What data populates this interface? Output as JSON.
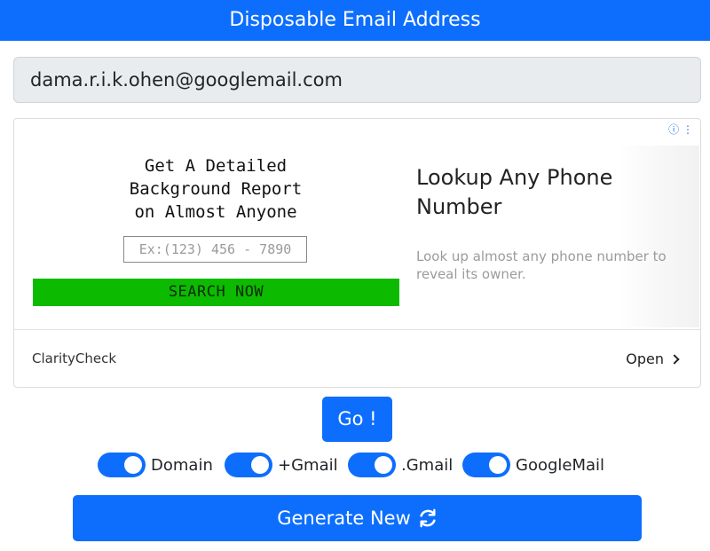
{
  "header": {
    "title": "Disposable Email Address"
  },
  "email": {
    "value": "dama.r.i.k.ohen@googlemail.com"
  },
  "ad": {
    "info_glyphs": "ⓘ ⋮",
    "image_headline": "Get A Detailed\nBackground Report\non Almost Anyone",
    "image_input_placeholder": "Ex:(123) 456 - 7890",
    "image_button_label": "SEARCH NOW",
    "headline": "Lookup Any Phone Number",
    "description": "Look up almost any phone number to reveal its owner.",
    "advertiser": "ClarityCheck",
    "open_label": "Open"
  },
  "go_button": {
    "label": "Go !"
  },
  "toggles": [
    {
      "label": "Domain",
      "on": true
    },
    {
      "label": "+Gmail",
      "on": true
    },
    {
      "label": ".Gmail",
      "on": true
    },
    {
      "label": "GoogleMail",
      "on": true
    }
  ],
  "generate_button": {
    "label": "Generate New",
    "icon": "refresh-icon"
  },
  "colors": {
    "primary": "#0d6efd",
    "ad_button": "#0cbb00"
  }
}
